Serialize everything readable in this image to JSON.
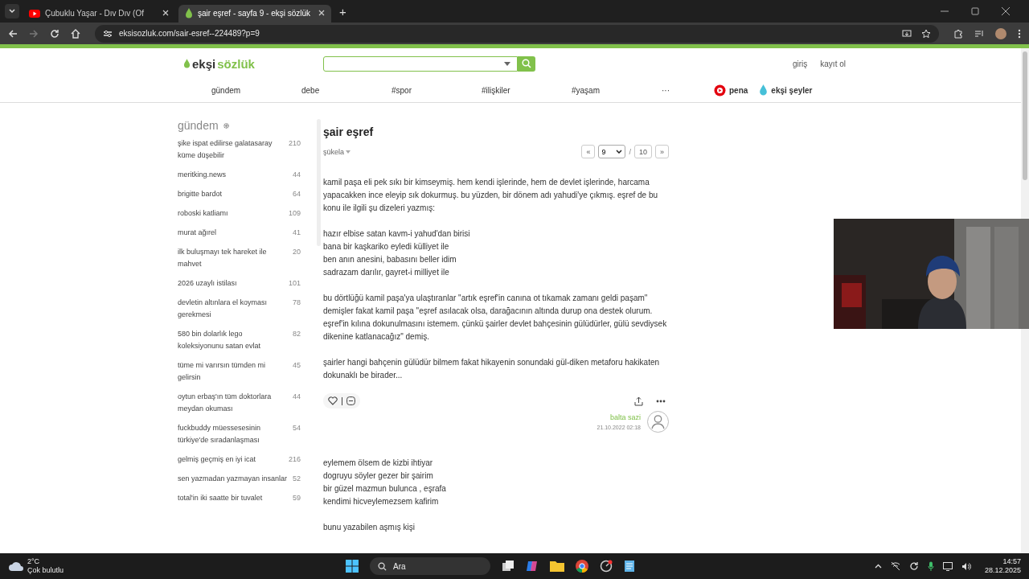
{
  "browser": {
    "tabs": [
      {
        "title": "Çubuklu Yaşar - Dıv Dıv (Of",
        "selected": false
      },
      {
        "title": "şair eşref - sayfa 9 - ekşi sözlük",
        "selected": true
      }
    ],
    "new_tab": "+",
    "url": "eksisozluk.com/sair-esref--224489?p=9"
  },
  "header": {
    "logo": {
      "first": "ekşi",
      "second": "sözlük"
    },
    "auth": [
      "giriş",
      "kayıt ol"
    ],
    "nav": [
      "gündem",
      "debe",
      "#spor",
      "#ilişkiler",
      "#yaşam",
      "···"
    ],
    "partners": [
      {
        "label": "pena",
        "kind": "pena"
      },
      {
        "label": "ekşi şeyler",
        "kind": "drop"
      }
    ]
  },
  "sidebar": {
    "title": "gündem",
    "items": [
      {
        "title": "şike ispat edilirse galatasaray küme düşebilir",
        "count": "210"
      },
      {
        "title": "meritking.news",
        "count": "44"
      },
      {
        "title": "brigitte bardot",
        "count": "64"
      },
      {
        "title": "roboski katliamı",
        "count": "109"
      },
      {
        "title": "murat ağırel",
        "count": "41"
      },
      {
        "title": "ilk buluşmayı tek hareket ile mahvet",
        "count": "20"
      },
      {
        "title": "2026 uzaylı istilası",
        "count": "101"
      },
      {
        "title": "devletin altınlara el koyması gerekmesi",
        "count": "78"
      },
      {
        "title": "580 bin dolarlık lego koleksiyonunu satan evlat",
        "count": "82"
      },
      {
        "title": "tüme mi varırsın tümden mi gelirsin",
        "count": "45"
      },
      {
        "title": "oytun erbaş'ın tüm doktorlara meydan okuması",
        "count": "44"
      },
      {
        "title": "fuckbuddy müessesesinin türkiye'de sıradanlaşması",
        "count": "54"
      },
      {
        "title": "gelmiş geçmiş en iyi icat",
        "count": "216"
      },
      {
        "title": "sen yazmadan yazmayan insanlar",
        "count": "52"
      },
      {
        "title": "total'in iki saatte bir tuvalet",
        "count": "59"
      }
    ]
  },
  "topic": {
    "title": "şair eşref",
    "sort": "şükela",
    "pager": {
      "prev": "«",
      "current": "9",
      "separator": "/",
      "total": "10",
      "next": "»"
    }
  },
  "entries": [
    {
      "paragraphs": [
        "kamil paşa eli pek sıkı bir kimseymiş. hem kendi işlerinde, hem de devlet işlerinde, harcama yapacakken ince eleyip sık dokurmuş. bu yüzden, bir dönem adı yahudi'ye çıkmış. eşref de bu konu ile ilgili şu dizeleri yazmış:",
        "hazır elbise satan kavm-i yahud'dan birisi\nbana bir kaşkariko eyledi külliyet ile\nben anın anesini, babasını beller idim\nsadrazam darılır, gayret-i milliyet ile",
        "bu dörtlüğü kamil paşa'ya ulaştıranlar \"artık eşref'in canına ot tıkamak zamanı geldi paşam\" demişler fakat kamil paşa \"eşref asılacak olsa, darağacının altında durup ona destek olurum. eşref'in kılına dokunulmasını istemem. çünkü şairler devlet bahçesinin gülüdürler, gülü sevdiysek dikenine katlanacağız\" demiş.",
        "şairler hangi bahçenin gülüdür bilmem fakat hikayenin sonundaki gül-diken metaforu hakikaten dokunaklı be birader..."
      ],
      "author": "balta sazi",
      "date": "21.10.2022 02:18"
    },
    {
      "paragraphs": [
        "eylemem ölsem de kizbi ihtiyar\ndogruyu söyler gezer bir şairim\nbir güzel mazmun bulunca , eşrafa\nkendimi hicveylemezsem kafirim",
        "bunu yazabilen aşmış kişi"
      ]
    }
  ],
  "taskbar": {
    "weather": {
      "temp": "2°C",
      "desc": "Çok bulutlu"
    },
    "search": "Ara",
    "time": "14:57",
    "date": "28.12.2025"
  }
}
